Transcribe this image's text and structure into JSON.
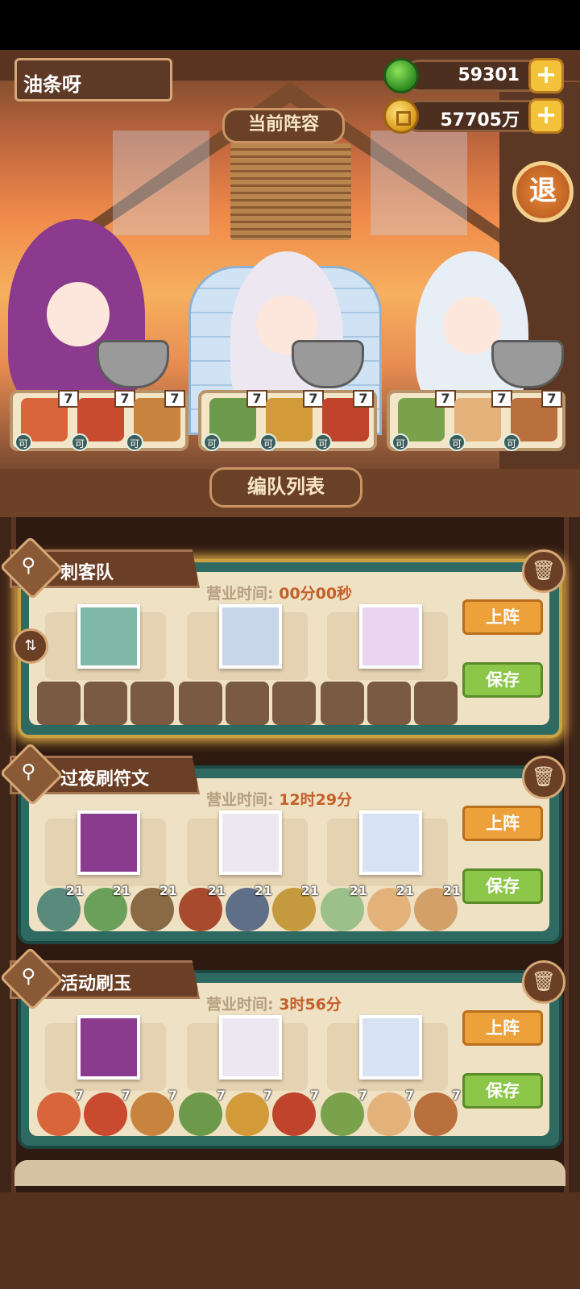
{
  "player": {
    "name": "油条呀"
  },
  "resources": [
    {
      "icon": "gem-icon",
      "value": "59301"
    },
    {
      "icon": "coin-icon",
      "value": "57705万"
    }
  ],
  "scene": {
    "current_lineup_label": "当前阵容",
    "exit_label": "退",
    "dish_panels": [
      {
        "dishes": [
          {
            "count": "7",
            "can": "可"
          },
          {
            "count": "7",
            "can": "可"
          },
          {
            "count": "7",
            "can": "可"
          }
        ]
      },
      {
        "dishes": [
          {
            "count": "7",
            "can": "可"
          },
          {
            "count": "7",
            "can": "可"
          },
          {
            "count": "7",
            "can": "可"
          }
        ]
      },
      {
        "dishes": [
          {
            "count": "7",
            "can": "可"
          },
          {
            "count": "7",
            "can": "可"
          },
          {
            "count": "7",
            "can": "可"
          }
        ]
      }
    ]
  },
  "list": {
    "title": "编队列表",
    "teams": [
      {
        "name": "刺客队",
        "timer_label": "营业时间:",
        "timer_value": "00分00秒",
        "deploy": "上阵",
        "save": "保存",
        "foods": []
      },
      {
        "name": "过夜刷符文",
        "timer_label": "营业时间:",
        "timer_value": "12时29分",
        "deploy": "上阵",
        "save": "保存",
        "foods": [
          "21",
          "21",
          "21",
          "21",
          "21",
          "21",
          "21",
          "21",
          "21"
        ]
      },
      {
        "name": "活动刷玉",
        "timer_label": "营业时间:",
        "timer_value": "3时56分",
        "deploy": "上阵",
        "save": "保存",
        "foods": [
          "7",
          "7",
          "7",
          "7",
          "7",
          "7",
          "7",
          "7",
          "7"
        ]
      }
    ]
  },
  "colors": {
    "accent": "#eca13a",
    "save": "#8cc749",
    "card": "#2f6a62",
    "timer": "#c3602a"
  }
}
